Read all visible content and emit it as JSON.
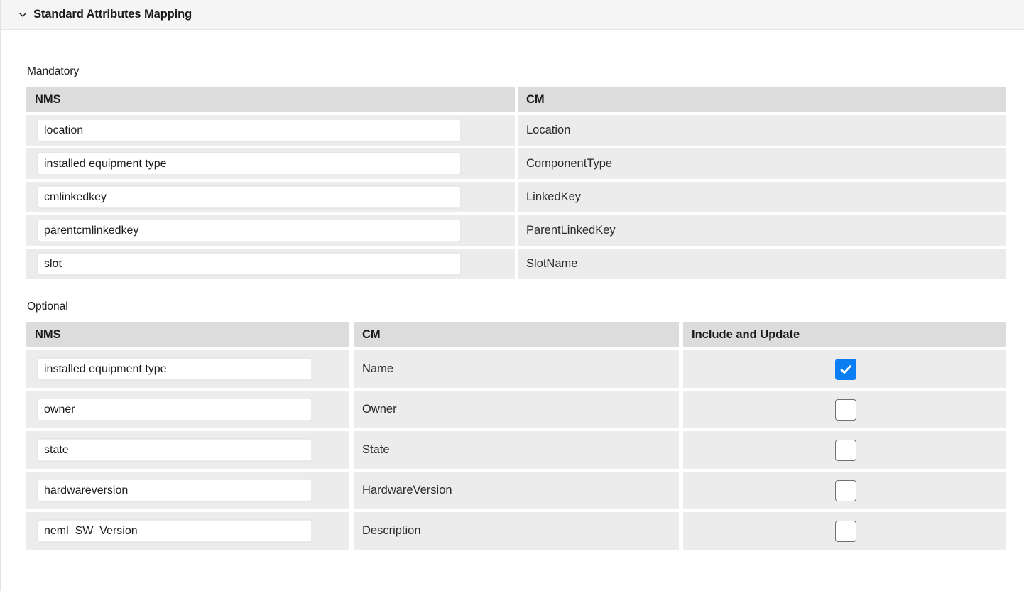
{
  "header": {
    "title": "Standard Attributes Mapping",
    "chevron_icon": "chevron-down-icon",
    "expanded": true
  },
  "colors": {
    "header_bg": "#f5f5f5",
    "table_header_bg": "#dcdcdc",
    "row_bg": "#ececec",
    "checkbox_accent": "#0b7ef4",
    "text": "#1b1b1b"
  },
  "mandatory": {
    "label": "Mandatory",
    "columns": [
      "NMS",
      "CM"
    ],
    "rows": [
      {
        "nms": "location",
        "cm": "Location"
      },
      {
        "nms": "installed equipment type",
        "cm": "ComponentType"
      },
      {
        "nms": "cmlinkedkey",
        "cm": "LinkedKey"
      },
      {
        "nms": "parentcmlinkedkey",
        "cm": "ParentLinkedKey"
      },
      {
        "nms": "slot",
        "cm": "SlotName"
      }
    ]
  },
  "optional": {
    "label": "Optional",
    "columns": [
      "NMS",
      "CM",
      "Include and Update"
    ],
    "rows": [
      {
        "nms": "installed equipment type",
        "cm": "Name",
        "include_and_update": true
      },
      {
        "nms": "owner",
        "cm": "Owner",
        "include_and_update": false
      },
      {
        "nms": "state",
        "cm": "State",
        "include_and_update": false
      },
      {
        "nms": "hardwareversion",
        "cm": "HardwareVersion",
        "include_and_update": false
      },
      {
        "nms": "neml_SW_Version",
        "cm": "Description",
        "include_and_update": false
      }
    ]
  }
}
